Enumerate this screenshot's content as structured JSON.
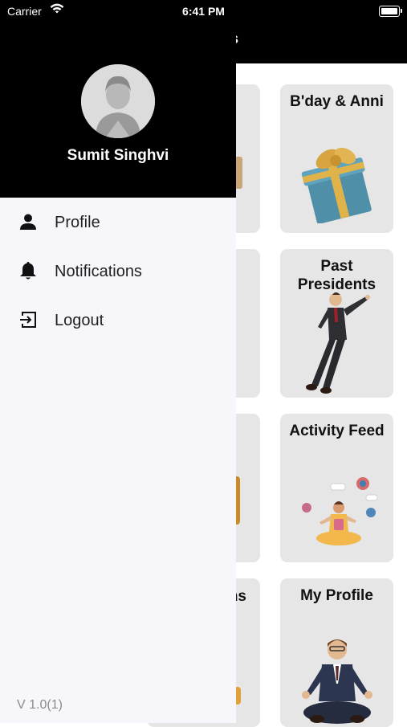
{
  "status_bar": {
    "carrier": "Carrier",
    "time": "6:41 PM",
    "battery_level": 1.0
  },
  "drawer": {
    "user_name": "Sumit Singhvi",
    "menu": [
      {
        "label": "Profile",
        "icon": "person-icon"
      },
      {
        "label": "Notifications",
        "icon": "bell-icon"
      },
      {
        "label": "Logout",
        "icon": "logout-icon"
      }
    ],
    "version": "V 1.0(1)"
  },
  "background_app": {
    "header_fragment": "s",
    "cards": [
      {
        "title": "B'day & Anni",
        "art": "gift-box"
      },
      {
        "title": "Past\nPresidents",
        "art": "man-leaning"
      },
      {
        "title": "Activity Feed",
        "art": "meditating-woman"
      },
      {
        "title": "My Profile",
        "art": "meditating-man"
      }
    ],
    "left_card_fragment": "ns"
  },
  "colors": {
    "header": "#000000",
    "drawer": "#f7f7fb",
    "card": "#e6e6e6",
    "text": "#222222",
    "version": "#8a8a8a"
  }
}
